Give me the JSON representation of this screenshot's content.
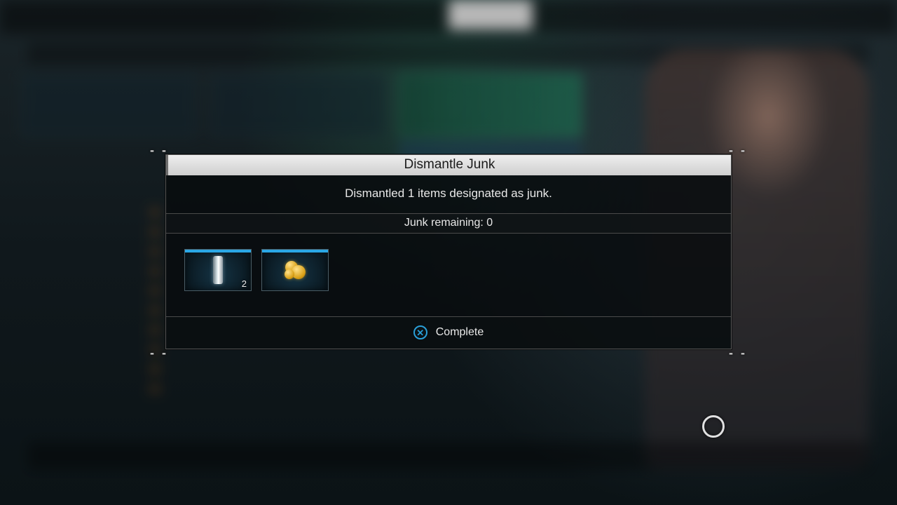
{
  "dialog": {
    "title": "Dismantle Junk",
    "message": "Dismantled 1 items designated as junk.",
    "remaining_label": "Junk remaining: 0",
    "footer": {
      "button_glyph": "✕",
      "action_label": "Complete"
    }
  },
  "items": [
    {
      "name": "titanium-cylinder",
      "count": "2",
      "rarity_color": "#2aa7e6"
    },
    {
      "name": "gold-nugget",
      "count": "",
      "rarity_color": "#2aa7e6"
    }
  ],
  "decor": {
    "dashes": "- -"
  }
}
